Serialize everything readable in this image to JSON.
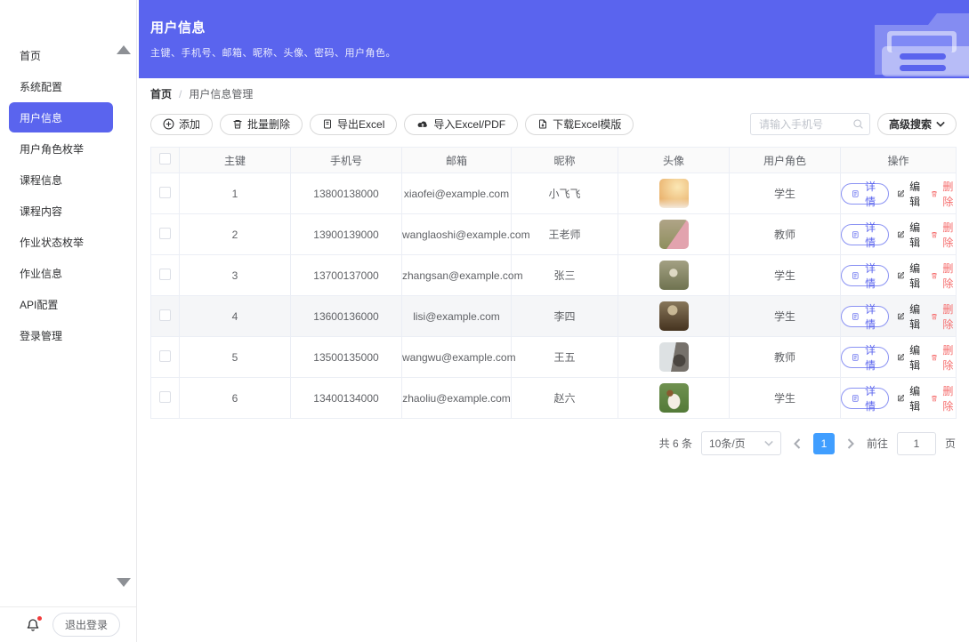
{
  "colors": {
    "primary": "#5a64ee",
    "danger": "#f56c6c",
    "page_active": "#409eff"
  },
  "sidebar": {
    "items": [
      {
        "label": "首页",
        "active": false
      },
      {
        "label": "系统配置",
        "active": false
      },
      {
        "label": "用户信息",
        "active": true
      },
      {
        "label": "用户角色枚举",
        "active": false
      },
      {
        "label": "课程信息",
        "active": false
      },
      {
        "label": "课程内容",
        "active": false
      },
      {
        "label": "作业状态枚举",
        "active": false
      },
      {
        "label": "作业信息",
        "active": false
      },
      {
        "label": "API配置",
        "active": false
      },
      {
        "label": "登录管理",
        "active": false
      }
    ],
    "logout_label": "退出登录"
  },
  "banner": {
    "title": "用户信息",
    "subtitle": "主键、手机号、邮箱、昵称、头像、密码、用户角色。"
  },
  "breadcrumb": {
    "home": "首页",
    "separator": "/",
    "current": "用户信息管理"
  },
  "toolbar": {
    "add": "添加",
    "batch_delete": "批量删除",
    "export_excel": "导出Excel",
    "import_excel": "导入Excel/PDF",
    "download_template": "下载Excel模版"
  },
  "search": {
    "placeholder": "请输入手机号",
    "advanced_label": "高级搜索"
  },
  "table": {
    "columns": [
      "主键",
      "手机号",
      "邮箱",
      "昵称",
      "头像",
      "用户角色",
      "操作"
    ],
    "actions": {
      "detail": "详情",
      "edit": "编辑",
      "delete": "删除"
    },
    "rows": [
      {
        "id": "1",
        "phone": "13800138000",
        "email": "xiaofei@example.com",
        "nickname": "小飞飞",
        "role": "学生",
        "avatar": "portrait-warm",
        "hover": false
      },
      {
        "id": "2",
        "phone": "13900139000",
        "email": "wanglaoshi@example.com",
        "nickname": "王老师",
        "role": "教师",
        "avatar": "hands-field",
        "hover": false
      },
      {
        "id": "3",
        "phone": "13700137000",
        "email": "zhangsan@example.com",
        "nickname": "张三",
        "role": "学生",
        "avatar": "person-field",
        "hover": false
      },
      {
        "id": "4",
        "phone": "13600136000",
        "email": "lisi@example.com",
        "nickname": "李四",
        "role": "学生",
        "avatar": "indoor-scene",
        "hover": true
      },
      {
        "id": "5",
        "phone": "13500135000",
        "email": "wangwu@example.com",
        "nickname": "王五",
        "role": "教师",
        "avatar": "window-silhouette",
        "hover": false
      },
      {
        "id": "6",
        "phone": "13400134000",
        "email": "zhaoliu@example.com",
        "nickname": "赵六",
        "role": "学生",
        "avatar": "puppy-grass",
        "hover": false
      }
    ]
  },
  "pagination": {
    "total_text": "共 6 条",
    "page_size": "10条/页",
    "current_page": "1",
    "goto_label": "前往",
    "goto_value": "1",
    "page_unit": "页"
  }
}
